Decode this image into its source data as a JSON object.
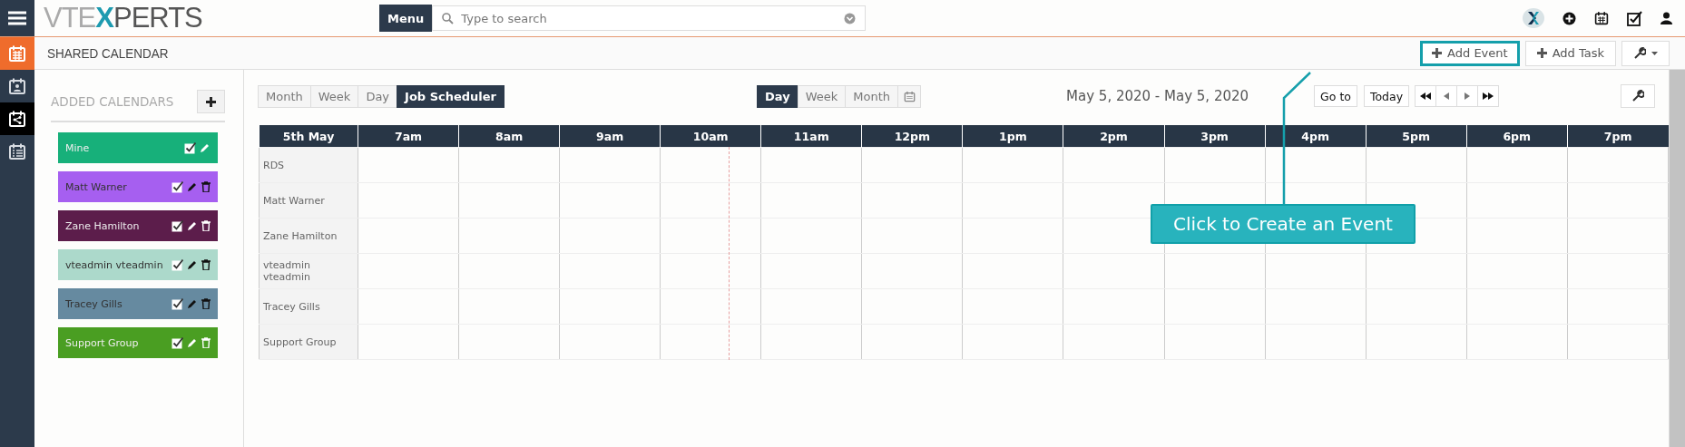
{
  "top_bar": {
    "logo": {
      "before": "VTE",
      "mark": "X",
      "after": "PERTS"
    },
    "menu_button": "Menu",
    "search": {
      "placeholder": "Type to search"
    }
  },
  "sidebar": {
    "items": [
      {
        "kind": "calendar",
        "module": true,
        "selected": false
      },
      {
        "kind": "contact-calendar",
        "module": false,
        "selected": false
      },
      {
        "kind": "shared-calendar",
        "module": false,
        "selected": true
      },
      {
        "kind": "list-calendar",
        "module": false,
        "selected": false
      }
    ]
  },
  "page_title": "SHARED CALENDAR",
  "header_buttons": [
    {
      "kind": "add",
      "label": "Add Event",
      "highlighted": true
    },
    {
      "kind": "add",
      "label": "Add Task",
      "highlighted": false
    },
    {
      "kind": "tools",
      "highlighted": false
    }
  ],
  "added_calendars": {
    "title": "ADDED CALENDARS",
    "calendars": [
      {
        "name": "Mine",
        "color": "#17b07a",
        "checked": true,
        "deletable": false,
        "dark_icons": false
      },
      {
        "name": "Matt Warner",
        "color": "#a65ff0",
        "checked": true,
        "deletable": true,
        "dark_icons": true
      },
      {
        "name": "Zane Hamilton",
        "color": "#5c1d4b",
        "checked": true,
        "deletable": true,
        "dark_icons": false
      },
      {
        "name": "vteadmin vteadmin",
        "color": "#acd9cb",
        "checked": true,
        "deletable": true,
        "dark_icons": true
      },
      {
        "name": "Tracey Gills",
        "color": "#668aa0",
        "checked": true,
        "deletable": true,
        "dark_icons": true
      },
      {
        "name": "Support Group",
        "color": "#4a9e22",
        "checked": true,
        "deletable": true,
        "dark_icons": false
      }
    ]
  },
  "view_tabs": [
    {
      "label": "Month",
      "selected": false
    },
    {
      "label": "Week",
      "selected": false
    },
    {
      "label": "Day",
      "selected": false
    },
    {
      "label": "Job Scheduler",
      "selected": true
    }
  ],
  "range_tabs": [
    {
      "label": "Day",
      "selected": true
    },
    {
      "label": "Week",
      "selected": false
    },
    {
      "label": "Month",
      "selected": false
    }
  ],
  "date_range": "May 5, 2020 - May 5, 2020",
  "nav_buttons": [
    "Go to",
    "Today"
  ],
  "table": {
    "columns": [
      "5th May",
      "7am",
      "8am",
      "9am",
      "10am",
      "11am",
      "12pm",
      "1pm",
      "2pm",
      "3pm",
      "4pm",
      "5pm",
      "6pm",
      "7pm"
    ],
    "rows": [
      "RDS",
      "Matt Warner",
      "Zane Hamilton",
      "vteadmin vteadmin",
      "Tracey Gills",
      "Support Group"
    ]
  },
  "callout": {
    "text": "Click to Create an Event"
  }
}
